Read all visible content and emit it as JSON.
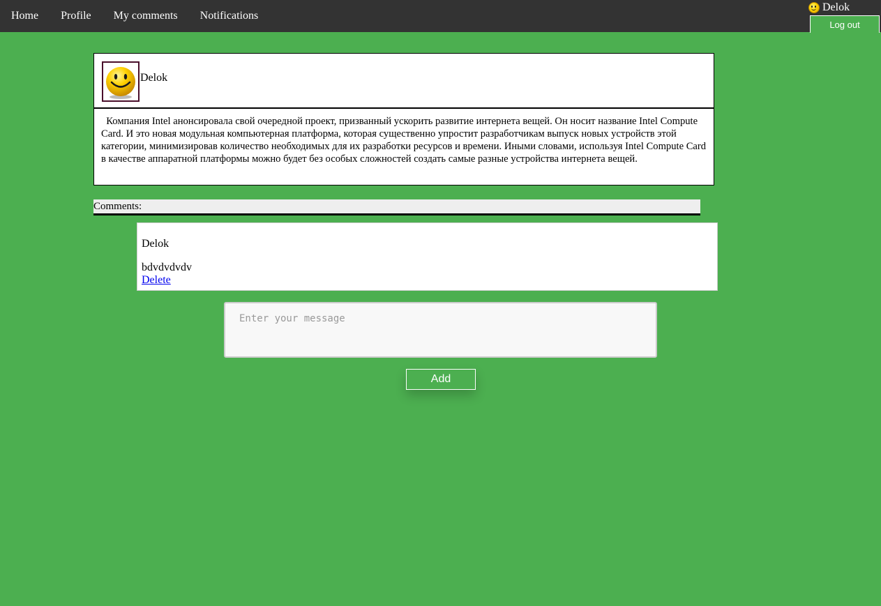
{
  "nav": {
    "items": [
      {
        "label": "Home"
      },
      {
        "label": "Profile"
      },
      {
        "label": "My comments"
      },
      {
        "label": "Notifications"
      }
    ]
  },
  "user": {
    "name": "Delok",
    "avatar_icon": "smiley-icon",
    "logout_label": "Log out"
  },
  "post": {
    "author": "Delok",
    "avatar_icon": "smiley-icon",
    "text": "Компания Intel анонсировала свой очередной проект, призванный ускорить развитие интернета вещей. Он носит название Intel Compute Card. И это новая модульная компьютерная платформа, которая существенно упростит разработчикам выпуск новых устройств этой категории, минимизировав количество необходимых для их разработки ресурсов и времени. Иными словами, используя Intel Compute Card в качестве аппаратной платформы можно будет без особых сложностей создать самые разные устройства интернета вещей."
  },
  "comments": {
    "label": "Comments:",
    "items": [
      {
        "author": "Delok",
        "text": "bdvdvdvdv",
        "delete_label": "Delete"
      }
    ]
  },
  "form": {
    "placeholder": "Enter your message",
    "value": "",
    "add_label": "Add"
  },
  "colors": {
    "background": "#4caf50",
    "topbar": "#333333",
    "link": "#0000ee"
  }
}
